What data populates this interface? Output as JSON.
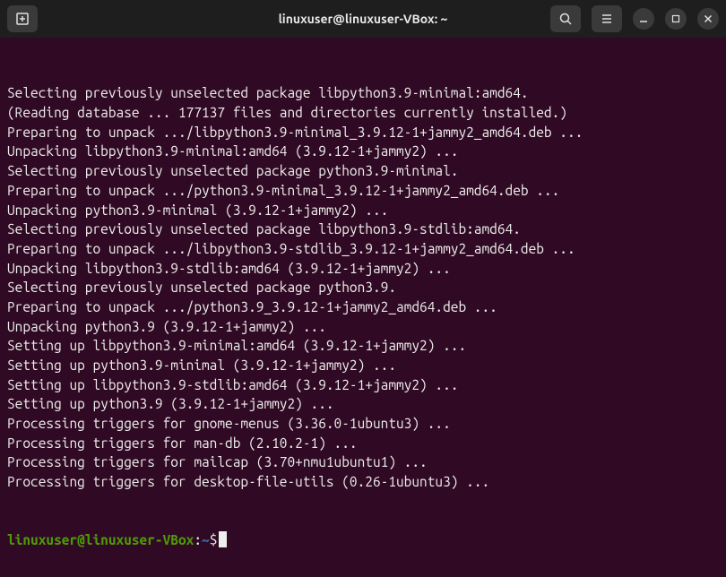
{
  "titlebar": {
    "title": "linuxuser@linuxuser-VBox: ~"
  },
  "terminal": {
    "lines": [
      "Selecting previously unselected package libpython3.9-minimal:amd64.",
      "(Reading database ... 177137 files and directories currently installed.)",
      "Preparing to unpack .../libpython3.9-minimal_3.9.12-1+jammy2_amd64.deb ...",
      "Unpacking libpython3.9-minimal:amd64 (3.9.12-1+jammy2) ...",
      "Selecting previously unselected package python3.9-minimal.",
      "Preparing to unpack .../python3.9-minimal_3.9.12-1+jammy2_amd64.deb ...",
      "Unpacking python3.9-minimal (3.9.12-1+jammy2) ...",
      "Selecting previously unselected package libpython3.9-stdlib:amd64.",
      "Preparing to unpack .../libpython3.9-stdlib_3.9.12-1+jammy2_amd64.deb ...",
      "Unpacking libpython3.9-stdlib:amd64 (3.9.12-1+jammy2) ...",
      "Selecting previously unselected package python3.9.",
      "Preparing to unpack .../python3.9_3.9.12-1+jammy2_amd64.deb ...",
      "Unpacking python3.9 (3.9.12-1+jammy2) ...",
      "Setting up libpython3.9-minimal:amd64 (3.9.12-1+jammy2) ...",
      "Setting up python3.9-minimal (3.9.12-1+jammy2) ...",
      "Setting up libpython3.9-stdlib:amd64 (3.9.12-1+jammy2) ...",
      "Setting up python3.9 (3.9.12-1+jammy2) ...",
      "Processing triggers for gnome-menus (3.36.0-1ubuntu3) ...",
      "Processing triggers for man-db (2.10.2-1) ...",
      "Processing triggers for mailcap (3.70+nmu1ubuntu1) ...",
      "Processing triggers for desktop-file-utils (0.26-1ubuntu3) ..."
    ],
    "prompt": {
      "user_host": "linuxuser@linuxuser-VBox",
      "colon": ":",
      "path": "~",
      "dollar": "$"
    }
  }
}
